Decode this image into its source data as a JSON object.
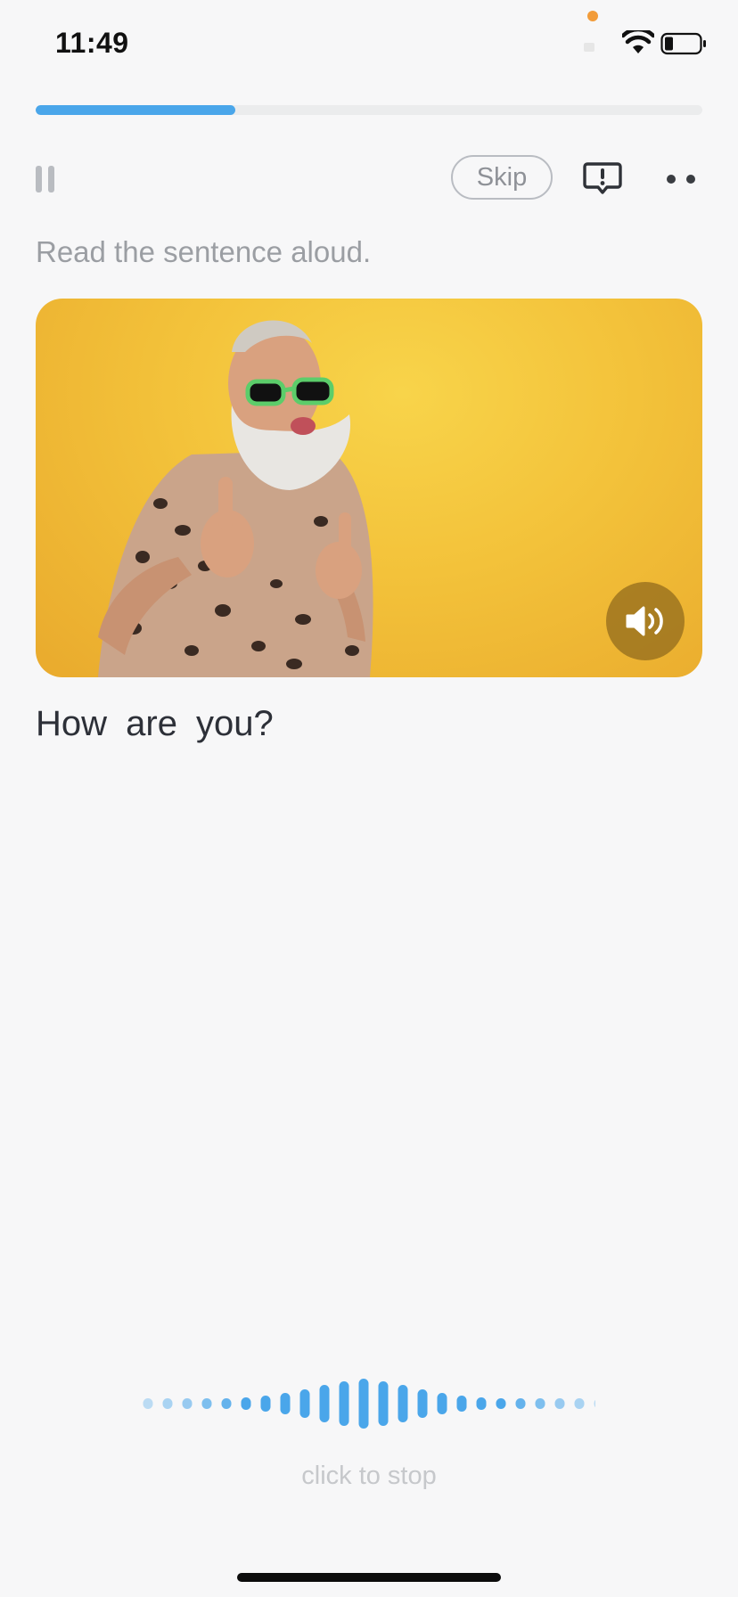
{
  "status_bar": {
    "time": "11:49"
  },
  "progress": {
    "value": 0.3
  },
  "toolbar": {
    "skip_label": "Skip"
  },
  "exercise": {
    "instruction": "Read the sentence aloud.",
    "sentence": "How are you?"
  },
  "recording": {
    "stop_label": "click to stop"
  },
  "colors": {
    "accent": "#4aa6ea",
    "card_background": "#f3c23a"
  },
  "icons": {
    "pause": "pause-icon",
    "report": "report-flag-icon",
    "more": "more-dots-icon",
    "audio": "speaker-icon",
    "wifi": "wifi-icon",
    "battery": "battery-icon"
  }
}
